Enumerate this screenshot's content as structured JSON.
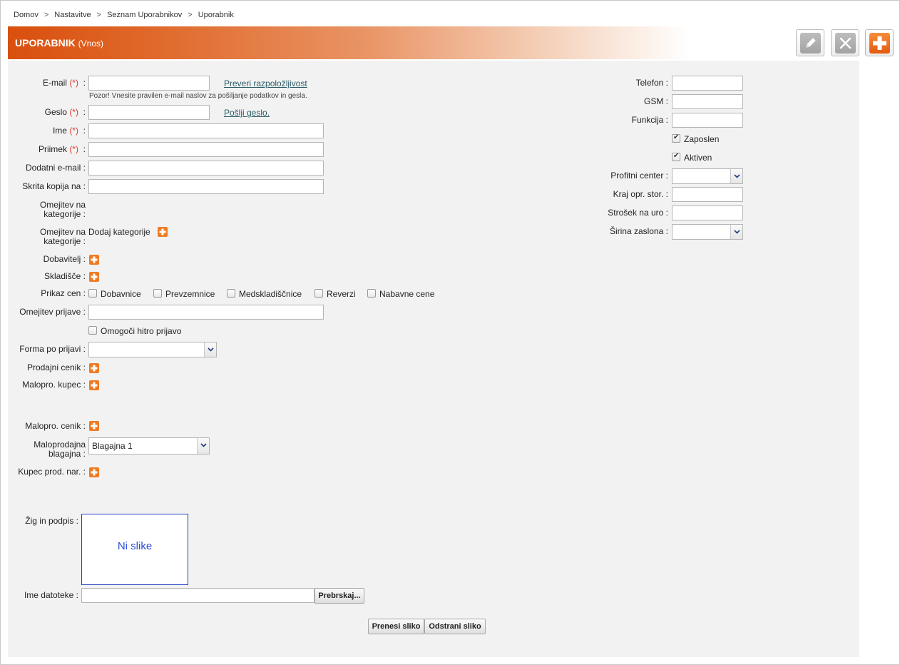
{
  "breadcrumb": [
    "Domov",
    "Nastavitve",
    "Seznam Uporabnikov",
    "Uporabnik"
  ],
  "breadcrumb_sep": ">",
  "header": {
    "title": "UPORABNIK",
    "subtitle": "(Vnos)"
  },
  "toolbar": {
    "edit_icon": "pencil-icon",
    "close_icon": "close-x-icon",
    "add_icon": "plus-icon"
  },
  "colors": {
    "accent": "#d94f0e",
    "required": "#e23b2e",
    "link": "#2b5b66",
    "panel": "#f2f2f2"
  },
  "left": {
    "email_label": "E-mail",
    "required_mark": "(*)",
    "colon": ":",
    "check_availability": "Preveri razpoložljivost",
    "email_hint": "Pozor! Vnesite pravilen e-mail naslov za pošiljanje podatkov in gesla.",
    "password_label": "Geslo",
    "send_password": "Pošlji geslo.",
    "name_label": "Ime",
    "surname_label": "Priimek",
    "extra_email_label": "Dodatni e-mail",
    "bcc_label": "Skrita kopija na",
    "cat_limit_label_1": "Omejitev na",
    "cat_limit_label_2": "kategorije :",
    "add_category": "Dodaj kategorije",
    "supplier_label": "Dobavitelj :",
    "warehouse_label": "Skladišče :",
    "price_display_label": "Prikaz cen :",
    "price_options": [
      "Dobavnice",
      "Prevzemnice",
      "Medskladiščnice",
      "Reverzi",
      "Nabavne cene"
    ],
    "login_limit_label": "Omejitev prijave :",
    "quick_login": "Omogoči hitro prijavo",
    "form_after_login_label": "Forma po prijavi :",
    "sales_pricelist_label": "Prodajni cenik :",
    "retail_customer_label": "Malopro. kupec :",
    "retail_pricelist_label": "Malopro. cenik :",
    "retail_register_label_1": "Maloprodajna",
    "retail_register_label_2": "blagajna :",
    "retail_register_value": "Blagajna 1",
    "customer_order_label": "Kupec prod. nar. :",
    "stamp_label": "Žig in podpis :",
    "no_image": "Ni slike",
    "filename_label": "Ime datoteke :",
    "browse": "Prebrskaj...",
    "upload": "Prenesi sliko",
    "remove": "Odstrani sliko"
  },
  "right": {
    "phone_label": "Telefon :",
    "gsm_label": "GSM :",
    "function_label": "Funkcija :",
    "employed": "Zaposlen",
    "active": "Aktiven",
    "profit_center_label": "Profitni center :",
    "place_label": "Kraj opr. stor. :",
    "hourly_cost_label": "Strošek na uro :",
    "screen_width_label": "Širina zaslona :",
    "employed_checked": true,
    "active_checked": true
  }
}
